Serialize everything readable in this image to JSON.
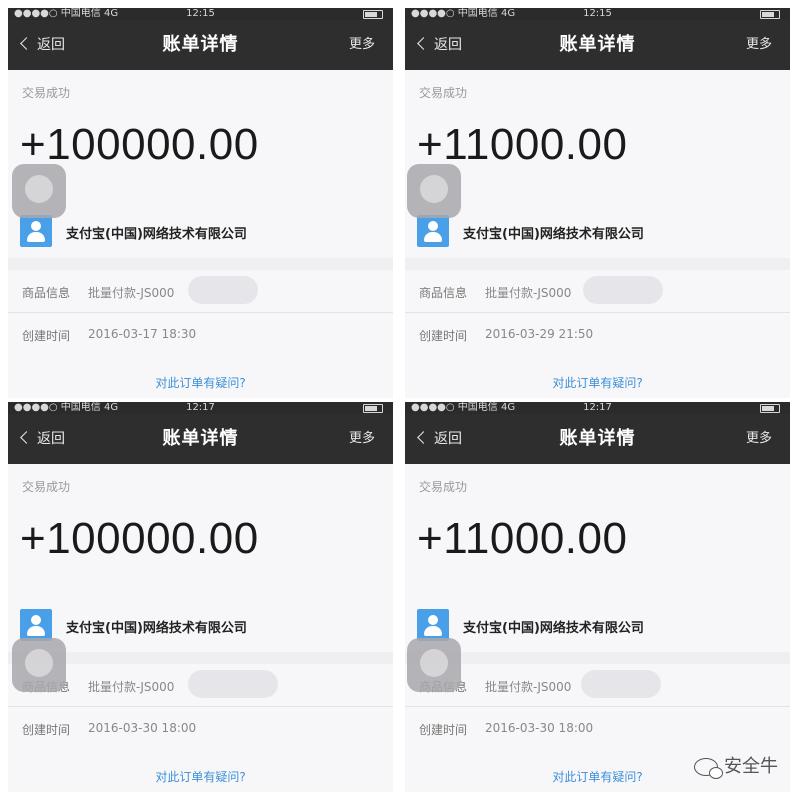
{
  "screens": [
    {
      "status_bar": {
        "carrier": "●●●●○ 中国电信  4G",
        "time": "12:15"
      },
      "nav": {
        "back": "返回",
        "title": "账单详情",
        "more": "更多"
      },
      "transaction_status": "交易成功",
      "amount": "+100000.00",
      "payer": "支付宝(中国)网络技术有限公司",
      "product_label": "商品信息",
      "product_value": "批量付款-JS000",
      "created_label": "创建时间",
      "created_value": "2016-03-17 18:30",
      "question_link": "对此订单有疑问?"
    },
    {
      "status_bar": {
        "carrier": "●●●●○ 中国电信  4G",
        "time": "12:15"
      },
      "nav": {
        "back": "返回",
        "title": "账单详情",
        "more": "更多"
      },
      "transaction_status": "交易成功",
      "amount": "+11000.00",
      "payer": "支付宝(中国)网络技术有限公司",
      "product_label": "商品信息",
      "product_value": "批量付款-JS000",
      "created_label": "创建时间",
      "created_value": "2016-03-29 21:50",
      "question_link": "对此订单有疑问?"
    },
    {
      "status_bar": {
        "carrier": "●●●●○ 中国电信  4G",
        "time": "12:17"
      },
      "nav": {
        "back": "返回",
        "title": "账单详情",
        "more": "更多"
      },
      "transaction_status": "交易成功",
      "amount": "+100000.00",
      "payer": "支付宝(中国)网络技术有限公司",
      "product_label": "商品信息",
      "product_value": "批量付款-JS000",
      "created_label": "创建时间",
      "created_value": "2016-03-30 18:00",
      "question_link": "对此订单有疑问?"
    },
    {
      "status_bar": {
        "carrier": "●●●●○ 中国电信  4G",
        "time": "12:17"
      },
      "nav": {
        "back": "返回",
        "title": "账单详情",
        "more": "更多"
      },
      "transaction_status": "交易成功",
      "amount": "+11000.00",
      "payer": "支付宝(中国)网络技术有限公司",
      "product_label": "商品信息",
      "product_value": "批量付款-JS000",
      "created_label": "创建时间",
      "created_value": "2016-03-30 18:00",
      "question_link": "对此订单有疑问?"
    }
  ],
  "watermark": {
    "text": "安全牛",
    "icon": "wechat-icon"
  },
  "colors": {
    "navbar": "#2e2e2e",
    "link": "#3d8fd9",
    "avatar": "#49a0e8"
  }
}
